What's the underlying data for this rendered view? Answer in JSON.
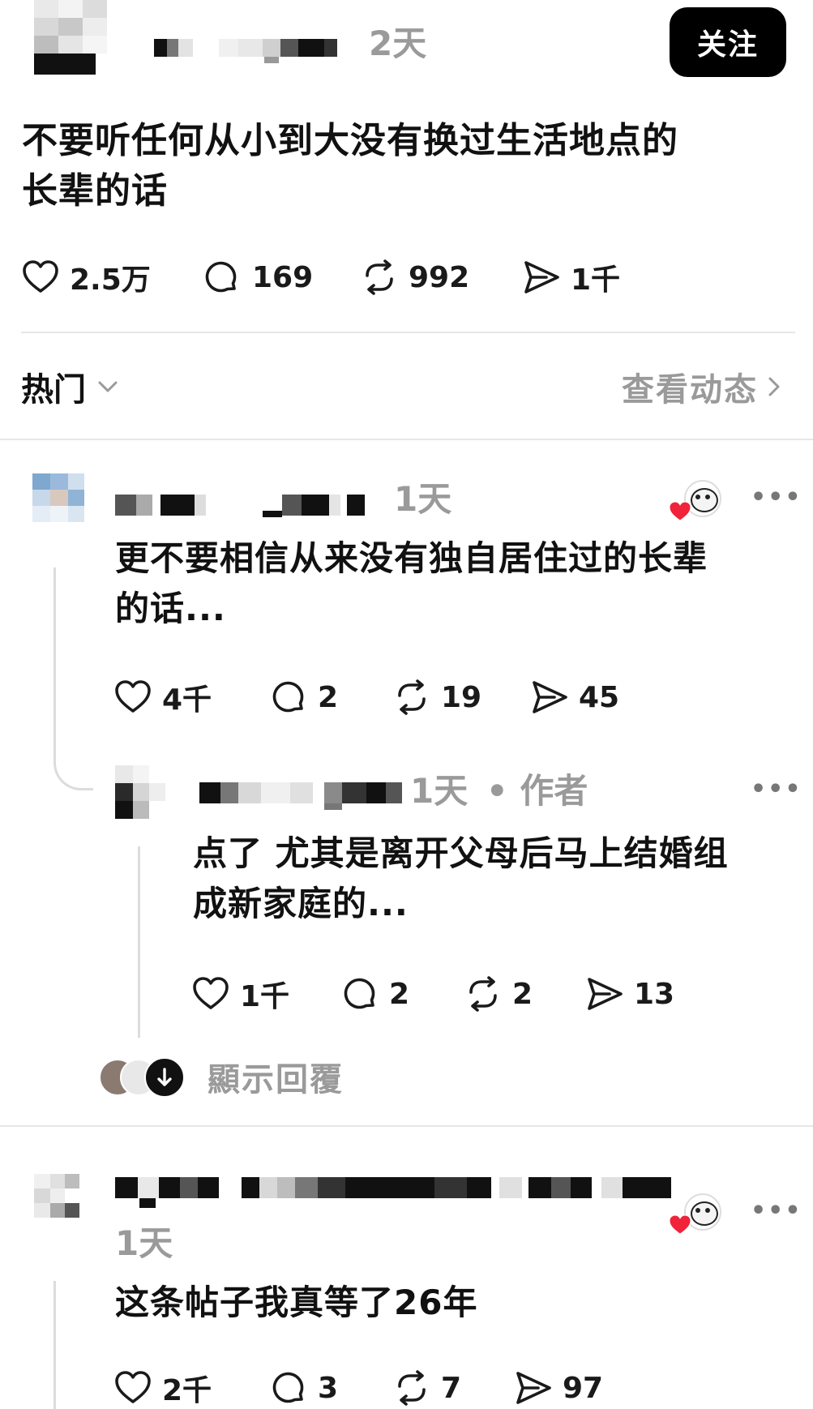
{
  "post": {
    "time": "2天",
    "follow_label": "关注",
    "text_line1": "不要听任何从小到大没有换过生活地点的",
    "text_line2": "长辈的话",
    "likes": "2.5万",
    "comments": "169",
    "reposts": "992",
    "shares": "1千"
  },
  "sort_bar": {
    "label": "热门",
    "activity_link": "查看动态"
  },
  "replies": [
    {
      "time": "1天",
      "text_line1": "更不要相信从来没有独自居住过的长辈",
      "text_line2": "的话...",
      "likes": "4千",
      "comments": "2",
      "reposts": "19",
      "shares": "45",
      "more": "•••",
      "nested": {
        "time": "1天",
        "author_tag": "• 作者",
        "text_line1": "点了 尤其是离开父母后马上结婚组",
        "text_line2": "成新家庭的...",
        "likes": "1千",
        "comments": "2",
        "reposts": "2",
        "shares": "13",
        "more": "•••"
      },
      "show_replies_label": "顯示回覆"
    },
    {
      "time": "1天",
      "text": "这条帖子我真等了26年",
      "likes": "2千",
      "comments": "3",
      "reposts": "7",
      "shares": "97",
      "more": "•••"
    }
  ],
  "icons": [
    "heart-icon",
    "comment-icon",
    "repost-icon",
    "share-icon",
    "chevron-down-icon",
    "chevron-right-icon",
    "more-icon",
    "arrow-down-icon"
  ],
  "colors": {
    "accent_red": "#f0233a",
    "gray_text": "#9a9a9a",
    "divider": "#e6e6e6"
  }
}
